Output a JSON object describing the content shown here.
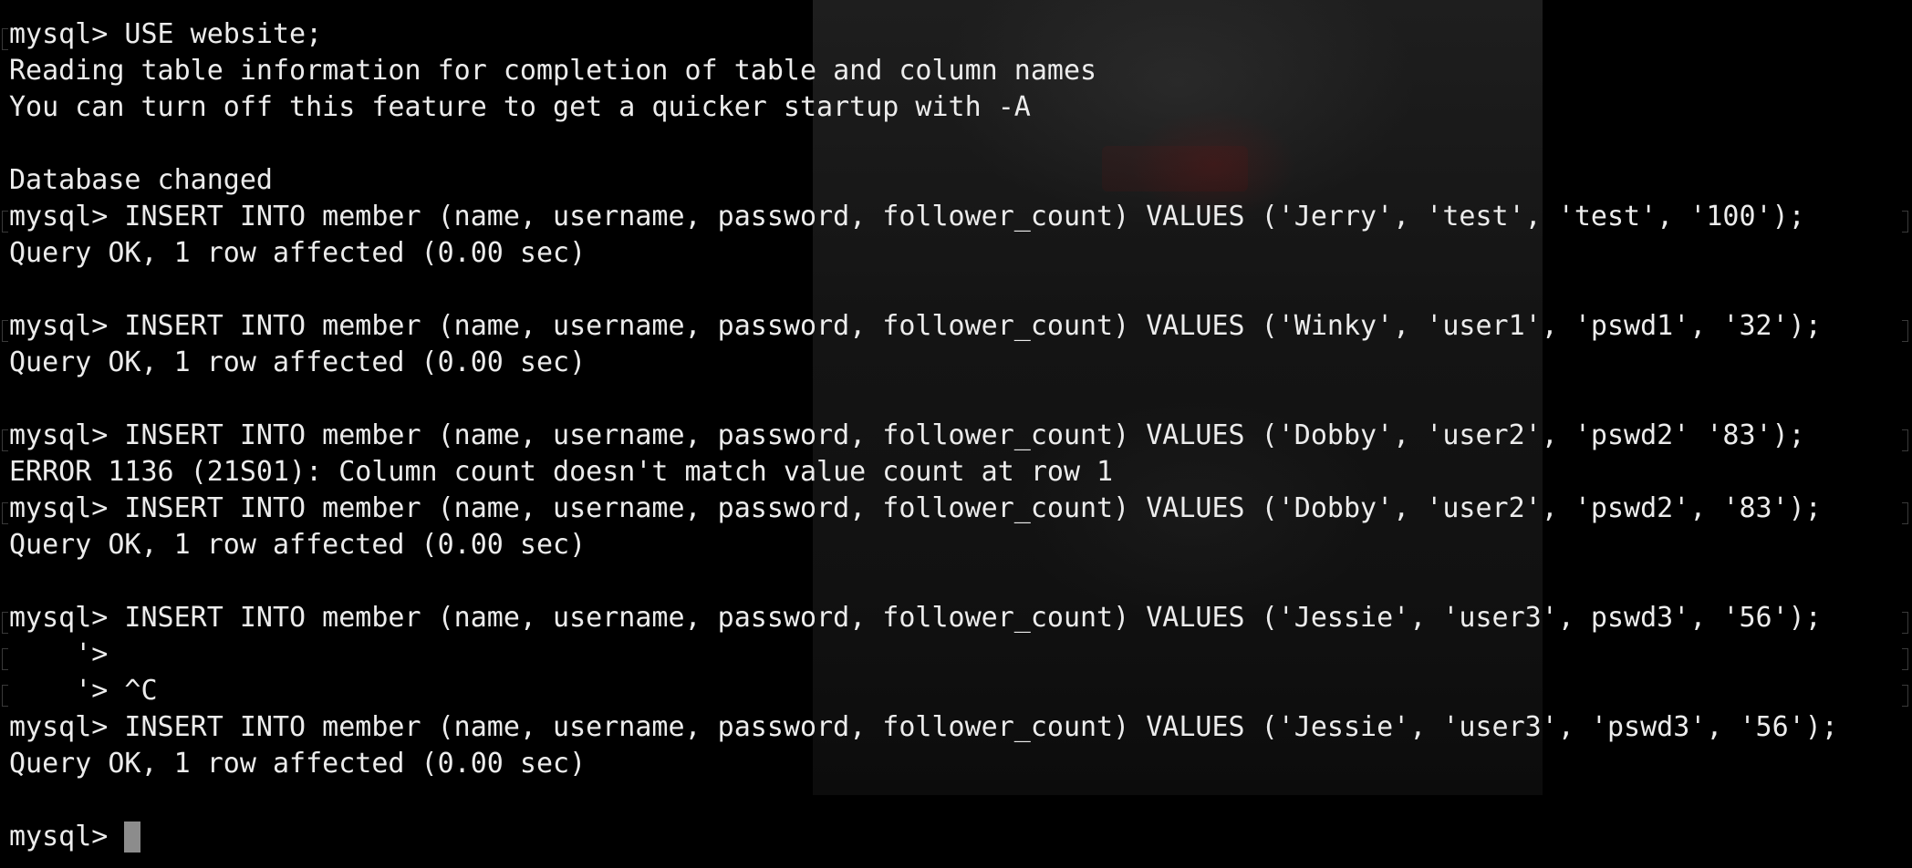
{
  "terminal": {
    "lines": [
      "mysql> USE website;",
      "Reading table information for completion of table and column names",
      "You can turn off this feature to get a quicker startup with -A",
      "",
      "Database changed",
      "mysql> INSERT INTO member (name, username, password, follower_count) VALUES ('Jerry', 'test', 'test', '100');",
      "Query OK, 1 row affected (0.00 sec)",
      "",
      "mysql> INSERT INTO member (name, username, password, follower_count) VALUES ('Winky', 'user1', 'pswd1', '32');",
      "Query OK, 1 row affected (0.00 sec)",
      "",
      "mysql> INSERT INTO member (name, username, password, follower_count) VALUES ('Dobby', 'user2', 'pswd2' '83');",
      "ERROR 1136 (21S01): Column count doesn't match value count at row 1",
      "mysql> INSERT INTO member (name, username, password, follower_count) VALUES ('Dobby', 'user2', 'pswd2', '83');",
      "Query OK, 1 row affected (0.00 sec)",
      "",
      "mysql> INSERT INTO member (name, username, password, follower_count) VALUES ('Jessie', 'user3', pswd3', '56');",
      "    '>",
      "    '> ^C",
      "mysql> INSERT INTO member (name, username, password, follower_count) VALUES ('Jessie', 'user3', 'pswd3', '56');",
      "Query OK, 1 row affected (0.00 sec)",
      ""
    ],
    "prompt": "mysql> ",
    "colors": {
      "background": "#000000",
      "text": "#ececec",
      "cursor": "#8c8c8c"
    }
  }
}
